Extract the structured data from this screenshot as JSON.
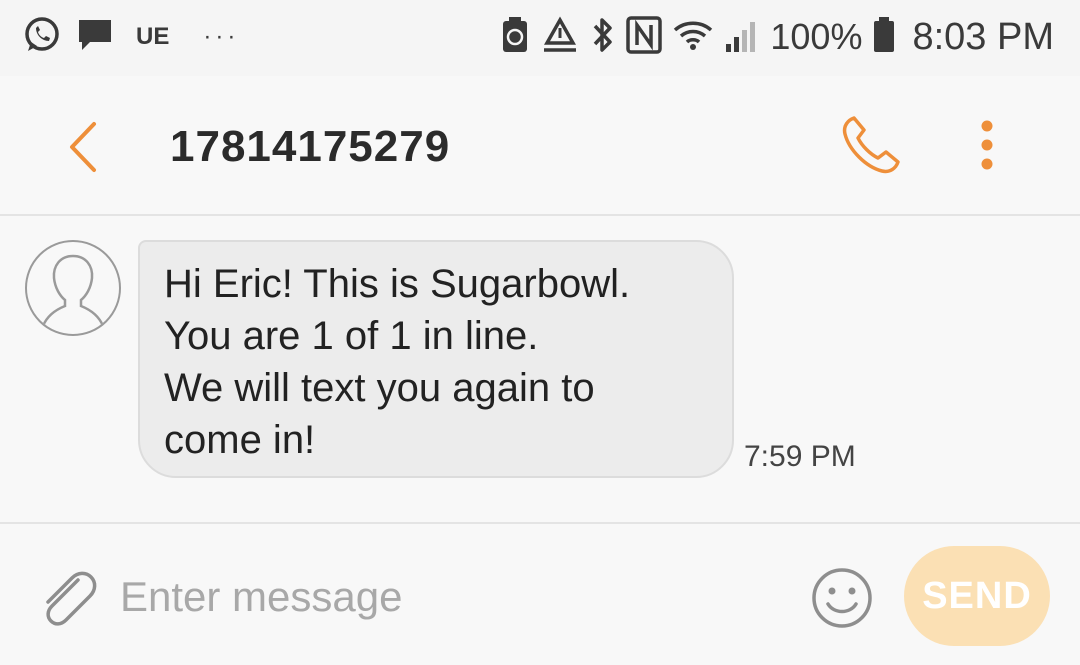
{
  "status_bar": {
    "left_icons": [
      "whatsapp-icon",
      "message-icon"
    ],
    "carrier_label": "UE",
    "more_dots": "···",
    "right_icons": [
      "battery-saver-icon",
      "recycle-icon",
      "bluetooth-icon",
      "nfc-icon",
      "wifi-icon",
      "signal-icon",
      "battery-icon"
    ],
    "battery_percent": "100%",
    "time": "8:03 PM"
  },
  "header": {
    "back_icon": "chevron-left-icon",
    "contact": "17814175279",
    "call_icon": "phone-icon",
    "more_icon": "more-vertical-icon"
  },
  "conversation": {
    "messages": [
      {
        "direction": "incoming",
        "avatar_icon": "person-icon",
        "lines": [
          "Hi Eric! This is Sugarbowl.",
          "You are 1 of 1 in line.",
          "We will text you again to",
          "come in!"
        ],
        "time": "7:59 PM"
      }
    ]
  },
  "composer": {
    "attach_icon": "paperclip-icon",
    "placeholder": "Enter message",
    "value": "",
    "emoji_icon": "smiley-icon",
    "send_label": "SEND"
  },
  "colors": {
    "accent": "#ee8f3a",
    "send_disabled_bg": "#fbe0b4",
    "bubble_bg": "#ececec"
  }
}
